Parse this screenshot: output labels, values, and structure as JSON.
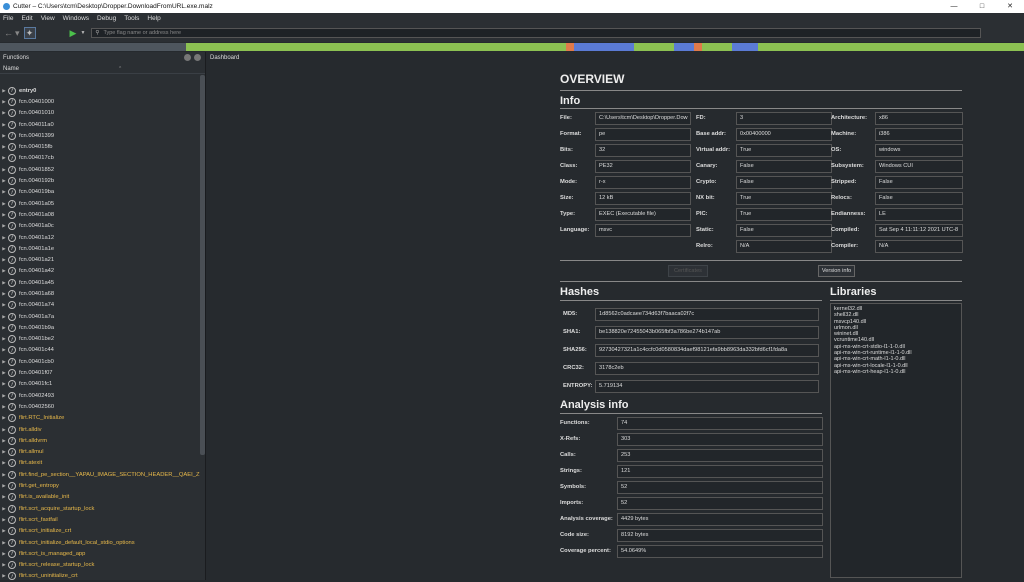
{
  "window": {
    "title": "Cutter – C:\\Users\\tcm\\Desktop\\Dropper.DownloadFromURL.exe.malz"
  },
  "menu": [
    "File",
    "Edit",
    "View",
    "Windows",
    "Debug",
    "Tools",
    "Help"
  ],
  "toolbar": {
    "flag_placeholder": "Type flag name or address here"
  },
  "colors": {
    "accent_flirt": "#e8b94a",
    "map_green": "#8cc152",
    "map_blue": "#5b7bd5"
  },
  "functions_panel": {
    "title": "Functions",
    "column": "Name",
    "items": [
      {
        "name": "entry0",
        "flirt": false,
        "bold": true
      },
      {
        "name": "fcn.00401000",
        "flirt": false
      },
      {
        "name": "fcn.00401010",
        "flirt": false
      },
      {
        "name": "fcn.004011a0",
        "flirt": false
      },
      {
        "name": "fcn.00401399",
        "flirt": false
      },
      {
        "name": "fcn.004015fb",
        "flirt": false
      },
      {
        "name": "fcn.004017cb",
        "flirt": false
      },
      {
        "name": "fcn.00401852",
        "flirt": false
      },
      {
        "name": "fcn.0040192b",
        "flirt": false
      },
      {
        "name": "fcn.004019ba",
        "flirt": false
      },
      {
        "name": "fcn.00401a05",
        "flirt": false
      },
      {
        "name": "fcn.00401a08",
        "flirt": false
      },
      {
        "name": "fcn.00401a0c",
        "flirt": false
      },
      {
        "name": "fcn.00401a12",
        "flirt": false
      },
      {
        "name": "fcn.00401a1e",
        "flirt": false
      },
      {
        "name": "fcn.00401a21",
        "flirt": false
      },
      {
        "name": "fcn.00401a42",
        "flirt": false
      },
      {
        "name": "fcn.00401a45",
        "flirt": false
      },
      {
        "name": "fcn.00401a68",
        "flirt": false
      },
      {
        "name": "fcn.00401a74",
        "flirt": false
      },
      {
        "name": "fcn.00401a7a",
        "flirt": false
      },
      {
        "name": "fcn.00401b9a",
        "flirt": false
      },
      {
        "name": "fcn.00401be2",
        "flirt": false
      },
      {
        "name": "fcn.00401c44",
        "flirt": false
      },
      {
        "name": "fcn.00401cb0",
        "flirt": false
      },
      {
        "name": "fcn.00401f07",
        "flirt": false
      },
      {
        "name": "fcn.00401fc1",
        "flirt": false
      },
      {
        "name": "fcn.00402493",
        "flirt": false
      },
      {
        "name": "fcn.00402560",
        "flirt": false
      },
      {
        "name": "flirt.RTC_Initialize",
        "flirt": true
      },
      {
        "name": "flirt.alldiv",
        "flirt": true
      },
      {
        "name": "flirt.alldvrm",
        "flirt": true
      },
      {
        "name": "flirt.allmul",
        "flirt": true
      },
      {
        "name": "flirt.atexit",
        "flirt": true
      },
      {
        "name": "flirt.find_pe_section__YAPAU_IMAGE_SECTION_HEADER__QAEI_Z",
        "flirt": true
      },
      {
        "name": "flirt.get_entropy",
        "flirt": true
      },
      {
        "name": "flirt.is_available_init",
        "flirt": true
      },
      {
        "name": "flirt.scrt_acquire_startup_lock",
        "flirt": true
      },
      {
        "name": "flirt.scrt_fastfail",
        "flirt": true
      },
      {
        "name": "flirt.scrt_initialize_crt",
        "flirt": true
      },
      {
        "name": "flirt.scrt_initialize_default_local_stdio_options",
        "flirt": true
      },
      {
        "name": "flirt.scrt_is_managed_app",
        "flirt": true
      },
      {
        "name": "flirt.scrt_release_startup_lock",
        "flirt": true
      },
      {
        "name": "flirt.scrt_uninitialize_crt",
        "flirt": true
      }
    ]
  },
  "dashboard": {
    "tab": "Dashboard",
    "overview_title": "OVERVIEW",
    "info_title": "Info",
    "info_col1": [
      {
        "label": "File:",
        "value": "C:\\Users\\tcm\\Desktop\\Dropper.Dow"
      },
      {
        "label": "Format:",
        "value": "pe"
      },
      {
        "label": "Bits:",
        "value": "32"
      },
      {
        "label": "Class:",
        "value": "PE32"
      },
      {
        "label": "Mode:",
        "value": "r-x"
      },
      {
        "label": "Size:",
        "value": "12 kB"
      },
      {
        "label": "Type:",
        "value": "EXEC (Executable file)"
      },
      {
        "label": "Language:",
        "value": "msvc"
      }
    ],
    "info_col2": [
      {
        "label": "FD:",
        "value": "3"
      },
      {
        "label": "Base addr:",
        "value": "0x00400000"
      },
      {
        "label": "Virtual addr:",
        "value": "True"
      },
      {
        "label": "Canary:",
        "value": "False"
      },
      {
        "label": "Crypto:",
        "value": "False"
      },
      {
        "label": "NX bit:",
        "value": "True"
      },
      {
        "label": "PIC:",
        "value": "True"
      },
      {
        "label": "Static:",
        "value": "False"
      },
      {
        "label": "Relro:",
        "value": "N/A"
      }
    ],
    "info_col3": [
      {
        "label": "Architecture:",
        "value": "x86"
      },
      {
        "label": "Machine:",
        "value": "i386"
      },
      {
        "label": "OS:",
        "value": "windows"
      },
      {
        "label": "Subsystem:",
        "value": "Windows CUI"
      },
      {
        "label": "Stripped:",
        "value": "False"
      },
      {
        "label": "Relocs:",
        "value": "False"
      },
      {
        "label": "Endianness:",
        "value": "LE"
      },
      {
        "label": "Compiled:",
        "value": "Sat Sep  4 11:11:12 2021 UTC-8"
      },
      {
        "label": "Compiler:",
        "value": "N/A"
      }
    ],
    "certificate_button": "Certificates",
    "version_button": "Version info",
    "hashes_title": "Hashes",
    "hashes": [
      {
        "label": "MD5:",
        "value": "1d8562c0adcaee734d63f7baaca02f7c"
      },
      {
        "label": "SHA1:",
        "value": "be138820e72455043b065fbf3a786be274b147ab"
      },
      {
        "label": "SHA256:",
        "value": "92730427321a1c4ccfc0d0580834daef98121efa9bb8963da332bfd6cf1fda8a"
      },
      {
        "label": "CRC32:",
        "value": "3178c2eb"
      },
      {
        "label": "ENTROPY:",
        "value": "5.719134"
      }
    ],
    "analysis_title": "Analysis info",
    "analysis": [
      {
        "label": "Functions:",
        "value": "74"
      },
      {
        "label": "X-Refs:",
        "value": "303"
      },
      {
        "label": "Calls:",
        "value": "253"
      },
      {
        "label": "Strings:",
        "value": "121"
      },
      {
        "label": "Symbols:",
        "value": "52"
      },
      {
        "label": "Imports:",
        "value": "52"
      },
      {
        "label": "Analysis coverage:",
        "value": "4429 bytes"
      },
      {
        "label": "Code size:",
        "value": "8192 bytes"
      },
      {
        "label": "Coverage percent:",
        "value": "54.0649%"
      }
    ],
    "libraries_title": "Libraries",
    "libraries": [
      "kernel32.dll",
      "shell32.dll",
      "msvcp140.dll",
      "urlmon.dll",
      "wininet.dll",
      "vcruntime140.dll",
      "api-ms-win-crt-stdio-l1-1-0.dll",
      "api-ms-win-crt-runtime-l1-1-0.dll",
      "api-ms-win-crt-math-l1-1-0.dll",
      "api-ms-win-crt-locale-l1-1-0.dll",
      "api-ms-win-crt-heap-l1-1-0.dll"
    ]
  }
}
